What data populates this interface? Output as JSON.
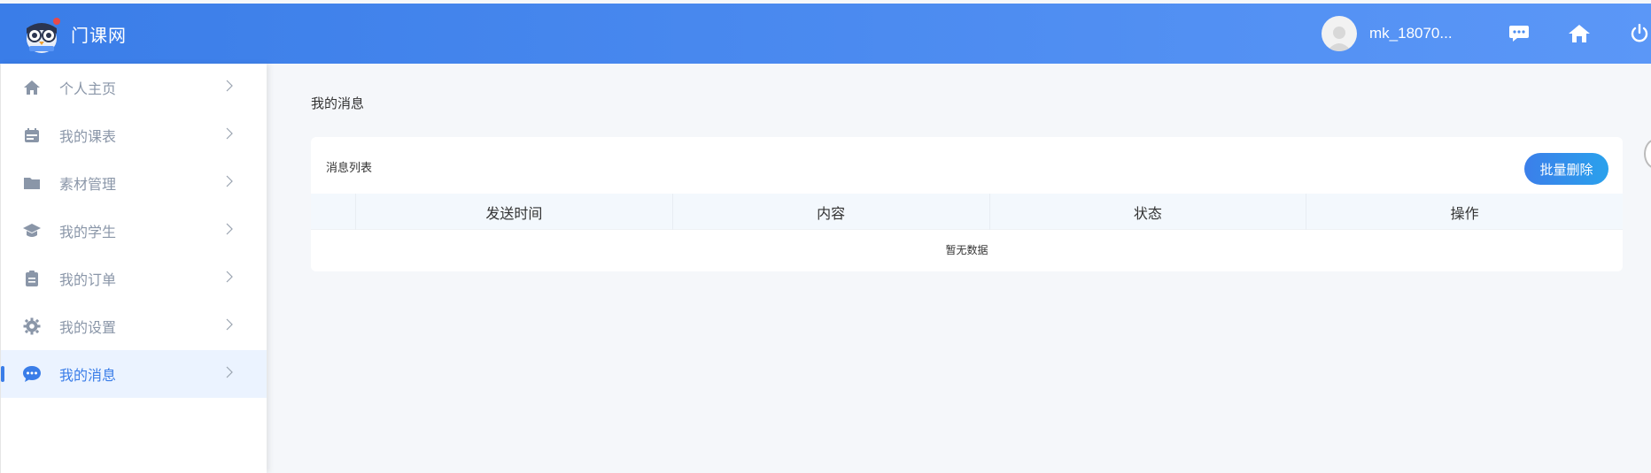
{
  "header": {
    "brand": "门课网",
    "username": "mk_18070...",
    "icons": [
      "chat-icon",
      "home-icon",
      "power-icon"
    ]
  },
  "sidebar": {
    "items": [
      {
        "label": "个人主页",
        "icon": "home-icon",
        "active": false
      },
      {
        "label": "我的课表",
        "icon": "calendar-icon",
        "active": false
      },
      {
        "label": "素材管理",
        "icon": "folder-icon",
        "active": false
      },
      {
        "label": "我的学生",
        "icon": "graduation-cap-icon",
        "active": false
      },
      {
        "label": "我的订单",
        "icon": "clipboard-icon",
        "active": false
      },
      {
        "label": "我的设置",
        "icon": "gear-icon",
        "active": false
      },
      {
        "label": "我的消息",
        "icon": "chat-icon",
        "active": true
      }
    ]
  },
  "main": {
    "page_title": "我的消息",
    "card_title": "消息列表",
    "batch_delete": "批量删除",
    "columns": [
      "发送时间",
      "内容",
      "状态",
      "操作"
    ],
    "empty_text": "暂无数据"
  },
  "colors": {
    "primary": "#3a7de8",
    "header_start": "#3a7de8",
    "header_end": "#5b97f7",
    "nav_text": "#8a96a8",
    "page_bg": "#f5f7fa"
  }
}
